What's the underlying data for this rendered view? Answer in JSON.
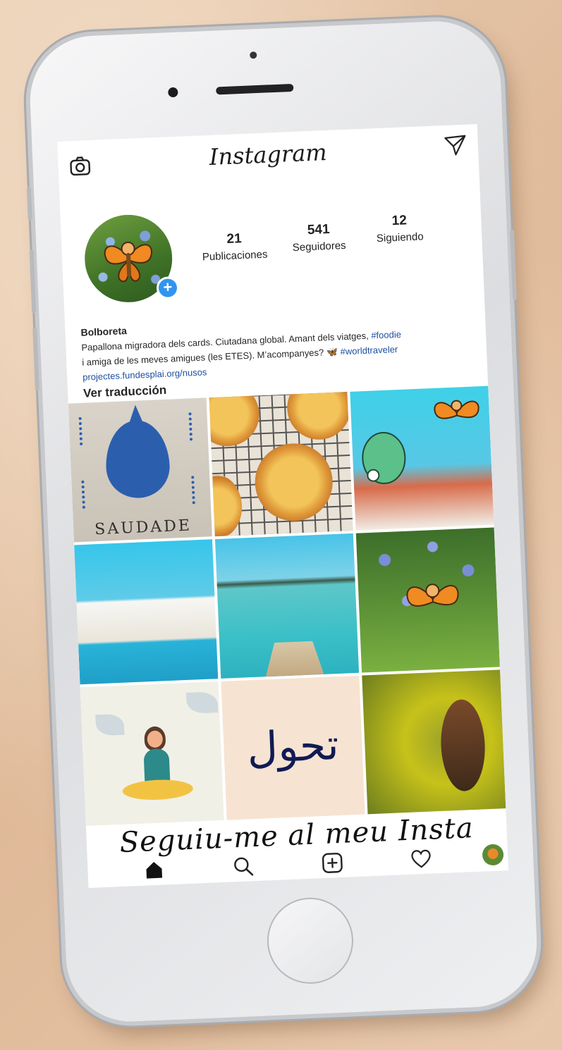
{
  "header": {
    "logo": "Instagram",
    "icons": [
      "camera-icon",
      "direct-message-icon"
    ]
  },
  "profile": {
    "stats": [
      {
        "count": "21",
        "label": "Publicaciones"
      },
      {
        "count": "541",
        "label": "Seguidores"
      },
      {
        "count": "12",
        "label": "Siguiendo"
      }
    ],
    "name": "Bolboreta",
    "bio_text": "Papallona migradora dels cards. Ciutadana global. Amant dels viatges,",
    "bio_tag1": "#foodie",
    "bio_text2": "i amiga de les meves amigues (les ETES). M’acompanyes?",
    "bio_emoji": "🦋",
    "bio_tag2": "#worldtraveler",
    "link": "projectes.fundesplai.org/nusos",
    "translate": "Ver traducción"
  },
  "grid": {
    "saudade_word": "SAUDADE",
    "arabic_word": "تحول"
  },
  "banner": "Seguiu-me al meu Insta",
  "tabbar": [
    "home-icon",
    "search-icon",
    "add-post-icon",
    "heart-icon",
    "profile-avatar"
  ],
  "colors": {
    "accent_blue": "#2f95f0",
    "link_blue": "#1d4ea0",
    "background": "#e3c3a4"
  }
}
